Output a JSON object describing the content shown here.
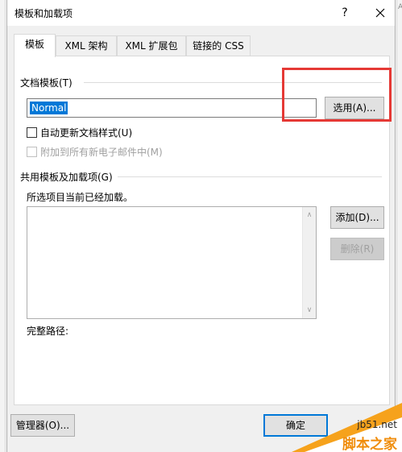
{
  "window": {
    "title": "模板和加载项",
    "help_label": "?",
    "close_label": "✕"
  },
  "tabs": [
    {
      "label": "模板",
      "active": true
    },
    {
      "label": "XML 架构",
      "active": false
    },
    {
      "label": "XML 扩展包",
      "active": false
    },
    {
      "label": "链接的 CSS",
      "active": false
    }
  ],
  "document_template": {
    "section_label": "文档模板(T)",
    "template_value": "Normal",
    "attach_button_label": "选用(A)...",
    "auto_update_label": "自动更新文档样式(U)",
    "auto_update_checked": false,
    "attach_new_email_label": "附加到所有新电子邮件中(M)",
    "attach_new_email_checked": false
  },
  "global_templates": {
    "section_label": "共用模板及加载项(G)",
    "info_text": "所选项目当前已经加载。",
    "items": [],
    "add_button_label": "添加(D)...",
    "remove_button_label": "删除(R)",
    "full_path_label": "完整路径:"
  },
  "footer": {
    "organizer_button_label": "管理器(O)...",
    "ok_button_label": "确定"
  },
  "watermark": {
    "site": "jb51.net",
    "text": "脚本之家"
  },
  "colors": {
    "highlight": "#e53935",
    "selection": "#0078d7",
    "watermark_orange": "#f6a21c"
  }
}
